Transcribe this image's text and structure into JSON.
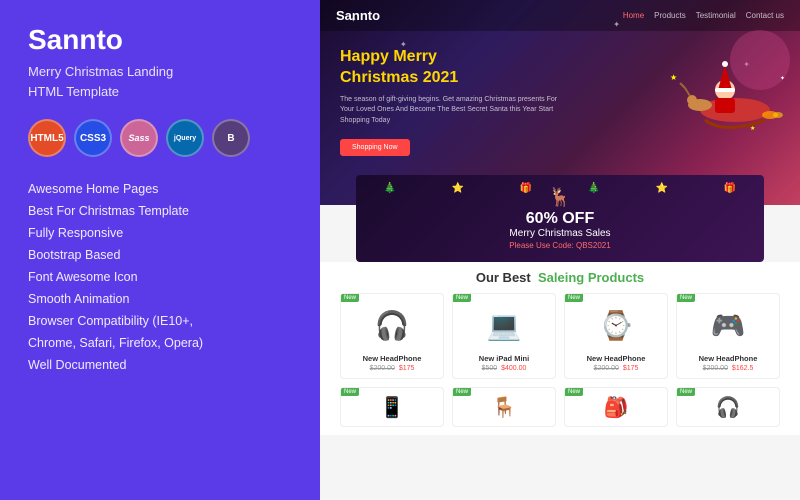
{
  "left": {
    "brand": "Sannto",
    "subtitle": "Merry Christmas Landing\nHTML Template",
    "badges": [
      {
        "label": "HTML5",
        "class": "badge-html",
        "text": "HTML 5"
      },
      {
        "label": "CSS3",
        "class": "badge-css",
        "text": "CSS 3"
      },
      {
        "label": "Sass",
        "class": "badge-sass",
        "text": "Sass"
      },
      {
        "label": "jQuery",
        "class": "badge-jquery",
        "text": "jQuery"
      },
      {
        "label": "Bootstrap",
        "class": "badge-bootstrap",
        "text": "B"
      }
    ],
    "features": [
      "Awesome Home Pages",
      "Best For Christmas Template",
      "Fully Responsive",
      "Bootstrap Based",
      "Font Awesome Icon",
      "Smooth Animation",
      "Browser Compatibility (IE10+,",
      "Chrome, Safari, Firefox, Opera)",
      "Well Documented"
    ]
  },
  "preview": {
    "nav": {
      "logo": "Sannto",
      "links": [
        "Home",
        "Products",
        "Testimonial",
        "Contact us"
      ]
    },
    "hero": {
      "title_line1": "Happy Merry",
      "title_line2": "Christmas",
      "title_year": "2021",
      "description": "The season of gift-giving begins. Get amazing Christmas presents\nFor Your Loved Ones And Become The Best Secret Santa this Year\nStart Shopping Today",
      "button": "Shopping Now"
    },
    "sale": {
      "reindeer": "🦌",
      "title": "60% OFF",
      "subtitle": "Merry Christmas Sales",
      "code_label": "Please Use Code: QBS2021"
    },
    "products": {
      "title_black": "Our Best",
      "title_green": "Saleing Products",
      "items": [
        {
          "name": "New HeadPhone",
          "emoji": "🎧",
          "old_price": "$200.00",
          "new_price": "$175",
          "tag": "New"
        },
        {
          "name": "New iPad Mini",
          "emoji": "💻",
          "old_price": "$500",
          "new_price": "$400.00",
          "tag": "New"
        },
        {
          "name": "New HeadPhone",
          "emoji": "⌚",
          "old_price": "$200.00",
          "new_price": "$175",
          "tag": "New"
        },
        {
          "name": "New HeadPhone",
          "emoji": "🎮",
          "old_price": "$200.00",
          "new_price": "$162.5",
          "tag": "New"
        }
      ],
      "row2": [
        {
          "emoji": "📱"
        },
        {
          "emoji": "🪑"
        },
        {
          "emoji": "🎒"
        },
        {
          "emoji": "🎧"
        }
      ]
    }
  }
}
